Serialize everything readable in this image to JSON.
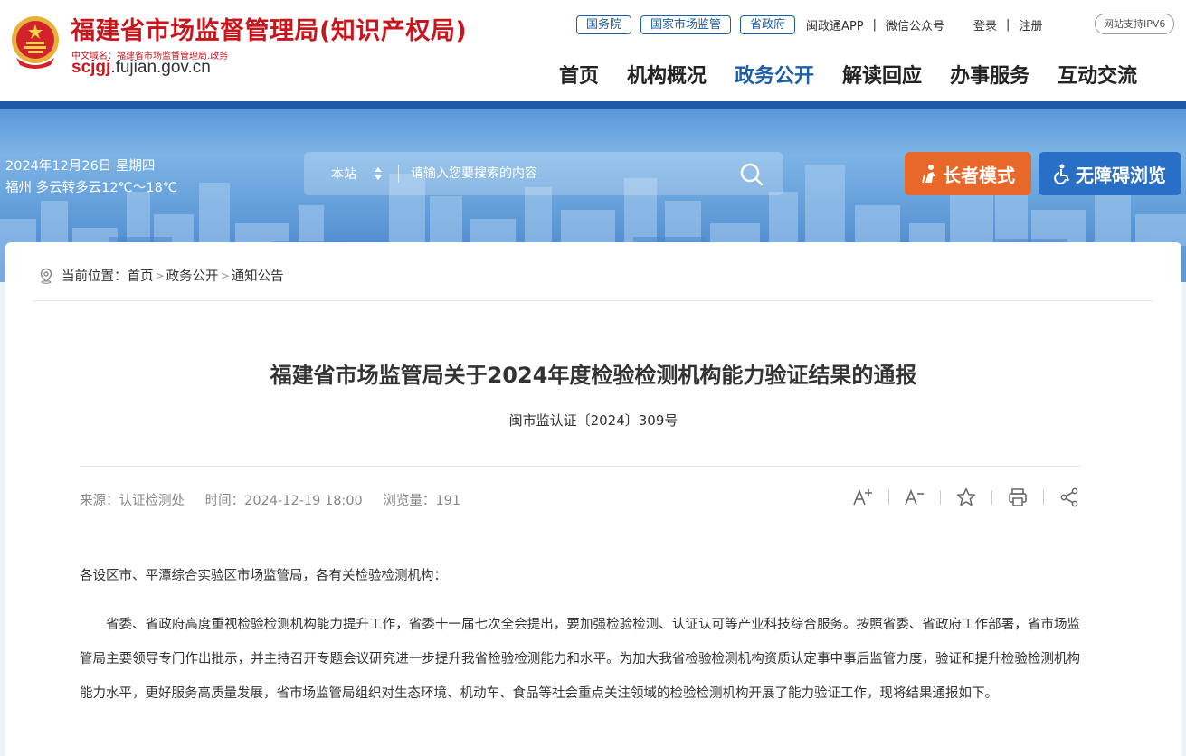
{
  "header": {
    "site_title": "福建省市场监督管理局(知识产权局)",
    "cn_domain": "中文域名：福建省市场监督管理局.政务",
    "domain_prefix": "scjgj",
    "domain_suffix": ".fujian.gov.cn",
    "top_pills": [
      "国务院",
      "国家市场监管",
      "省政府"
    ],
    "top_links": {
      "app": "闽政通APP",
      "wechat": "微信公众号",
      "login": "登录",
      "register": "注册"
    },
    "ipv6": "网站支持IPV6",
    "nav": [
      "首页",
      "机构概况",
      "政务公开",
      "解读回应",
      "办事服务",
      "互动交流"
    ],
    "active_nav": "政务公开"
  },
  "banner": {
    "date": "2024年12月26日 星期四",
    "weather": "福州 多云转多云12℃～18℃",
    "search_scope": "本站",
    "search_placeholder": "请输入您要搜索的内容",
    "elder_mode": "长者模式",
    "accessibility": "无障碍浏览"
  },
  "breadcrumb": {
    "label": "当前位置：",
    "items": [
      "首页",
      "政务公开",
      "通知公告"
    ]
  },
  "article": {
    "title": "福建省市场监管局关于2024年度检验检测机构能力验证结果的通报",
    "doc_no": "闽市监认证〔2024〕309号",
    "source": "来源：认证检测处",
    "time": "时间：2024-12-19 18:00",
    "views": "浏览量：191",
    "greeting": "各设区市、平潭综合实验区市场监管局，各有关检验检测机构：",
    "paragraph": "省委、省政府高度重视检验检测机构能力提升工作，省委十一届七次全会提出，要加强检验检测、认证认可等产业科技综合服务。按照省委、省政府工作部署，省市场监管局主要领导专门作出批示，并主持召开专题会议研究进一步提升我省检验检测能力和水平。为加大我省检验检测机构资质认定事中事后监管力度，验证和提升检验检测机构能力水平，更好服务高质量发展，省市场监管局组织对生态环境、机动车、食品等社会重点关注领域的检验检测机构开展了能力验证工作，现将结果通报如下。"
  },
  "colors": {
    "brand_red": "#c8161d",
    "brand_blue": "#1c5fa8",
    "elder_orange": "#e8682a",
    "access_blue": "#2a6fc6"
  }
}
